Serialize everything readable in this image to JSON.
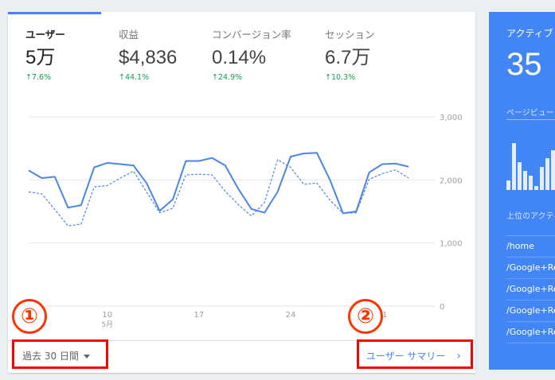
{
  "overview": {
    "metrics": [
      {
        "label": "ユーザー",
        "value": "5万",
        "change": "7.6%"
      },
      {
        "label": "収益",
        "value": "$4,836",
        "change": "44.1%"
      },
      {
        "label": "コンバージョン率",
        "value": "0.14%",
        "change": "24.9%"
      },
      {
        "label": "セッション",
        "value": "6.7万",
        "change": "10.3%"
      }
    ],
    "date_range": "過去 30 日間",
    "summary_link": "ユーザー サマリー"
  },
  "annotations": {
    "badge1": "①",
    "badge2": "②"
  },
  "colors": {
    "accent": "#4285f4",
    "positive": "#0f9d58",
    "highlight": "#ff0000"
  },
  "chart_data": {
    "type": "line",
    "y_ticks": [
      "3,000",
      "2,000",
      "1,000",
      "0"
    ],
    "ylim": [
      0,
      3000
    ],
    "x_ticks": [
      {
        "label": "10",
        "sub": "5月",
        "day": 10
      },
      {
        "label": "17",
        "sub": "",
        "day": 17
      },
      {
        "label": "24",
        "sub": "",
        "day": 24
      },
      {
        "label": "31",
        "sub": "",
        "day": 31
      }
    ],
    "grid": true,
    "x_days": [
      4,
      5,
      6,
      7,
      8,
      9,
      10,
      11,
      12,
      13,
      14,
      15,
      16,
      17,
      18,
      19,
      20,
      21,
      22,
      23,
      24,
      25,
      26,
      27,
      28,
      29,
      30,
      31,
      32,
      33,
      34,
      35
    ],
    "series": [
      {
        "values": [
          2150,
          2030,
          2050,
          1560,
          1600,
          2200,
          2270,
          2250,
          2230,
          1950,
          1510,
          1690,
          2300,
          2300,
          2350,
          2230,
          1860,
          1540,
          1480,
          1810,
          2370,
          2420,
          2430,
          2000,
          1470,
          1500,
          2120,
          2250,
          2260,
          2210
        ],
        "style": "solid"
      },
      {
        "values": [
          1810,
          1780,
          1530,
          1270,
          1300,
          1890,
          1910,
          2030,
          2140,
          1810,
          1480,
          1550,
          2080,
          2090,
          2080,
          1820,
          1610,
          1430,
          1640,
          2320,
          2200,
          1930,
          1950,
          1680,
          1470,
          1480,
          2010,
          2100,
          2160,
          2030
        ],
        "style": "dashed"
      }
    ]
  },
  "realtime": {
    "title": "アクティブ",
    "value": "35",
    "pageviews_label": "ページビュー",
    "top_pages_label": "上位のアクティブ",
    "bars": [
      0.18,
      0.92,
      0.55,
      0.38,
      0.28,
      0.08,
      0.45,
      0.62,
      0.78,
      0.3
    ],
    "pages": [
      "/home",
      "/Google+Re",
      "/Google+Re",
      "/Google+Re",
      "/Google+Re"
    ]
  }
}
